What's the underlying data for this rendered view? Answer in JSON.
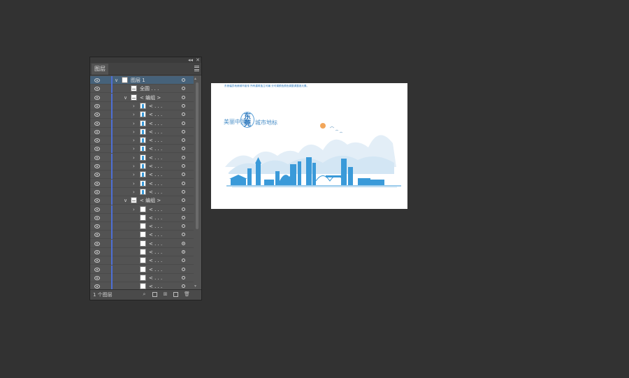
{
  "layers_panel": {
    "tab_title": "图层",
    "collapse_icon": "double-chevron-icon",
    "close_icon": "close-icon",
    "menu_icon": "panel-menu-icon",
    "rows": [
      {
        "label": "图层 1",
        "chevron": "∨",
        "thumb": "layer",
        "selected": true
      },
      {
        "label": "全圆 . . .",
        "chevron": "",
        "thumb": "line"
      },
      {
        "label": "< 编组 >",
        "chevron": "∨",
        "thumb": "line"
      },
      {
        "label": "< . . .",
        "chevron": "›",
        "thumb": "blue"
      },
      {
        "label": "< . . .",
        "chevron": "›",
        "thumb": "blue"
      },
      {
        "label": "< . . .",
        "chevron": "›",
        "thumb": "blue"
      },
      {
        "label": "< . . .",
        "chevron": "›",
        "thumb": "blue"
      },
      {
        "label": "< . . .",
        "chevron": "›",
        "thumb": "blue"
      },
      {
        "label": "< . . .",
        "chevron": "›",
        "thumb": "blue"
      },
      {
        "label": "< . . .",
        "chevron": "›",
        "thumb": "blue"
      },
      {
        "label": "< . . .",
        "chevron": "›",
        "thumb": "blue"
      },
      {
        "label": "< . . .",
        "chevron": "›",
        "thumb": "blue"
      },
      {
        "label": "< . . .",
        "chevron": "›",
        "thumb": "blue"
      },
      {
        "label": "< . . .",
        "chevron": "›",
        "thumb": "blue"
      },
      {
        "label": "< 编组 >",
        "chevron": "∨",
        "thumb": "line"
      },
      {
        "label": "< . . .",
        "chevron": "›",
        "thumb": "white"
      },
      {
        "label": "< . . .",
        "chevron": "",
        "thumb": "white"
      },
      {
        "label": "< . . .",
        "chevron": "",
        "thumb": "white"
      },
      {
        "label": "< . . .",
        "chevron": "",
        "thumb": "white"
      },
      {
        "label": "< . . .",
        "chevron": "",
        "thumb": "white",
        "target": "filled"
      },
      {
        "label": "< . . .",
        "chevron": "",
        "thumb": "white",
        "target": "filled"
      },
      {
        "label": "< . . .",
        "chevron": "",
        "thumb": "white"
      },
      {
        "label": "< . . .",
        "chevron": "",
        "thumb": "white"
      },
      {
        "label": "< . . .",
        "chevron": "",
        "thumb": "white"
      },
      {
        "label": "< . . .",
        "chevron": "",
        "thumb": "white"
      },
      {
        "label": "< . . .",
        "chevron": "",
        "thumb": "white"
      }
    ],
    "layer_count": "1 个图层",
    "bottom_icons": [
      "search-icon",
      "make-clipping-mask-icon",
      "new-sublayer-icon",
      "new-layer-icon",
      "delete-icon"
    ]
  },
  "artboard": {
    "header_text": "东莞幅员地貌城市宣传 所有建筑独立可编 分可调颜色颜色调整调整各元素。",
    "slogan_left": "美丽中国",
    "city_name": "东莞",
    "slogan_right": "城市地标",
    "colors": {
      "primary": "#2a8fd4",
      "light": "#cfe3f3",
      "accent": "#f2a65a"
    }
  }
}
